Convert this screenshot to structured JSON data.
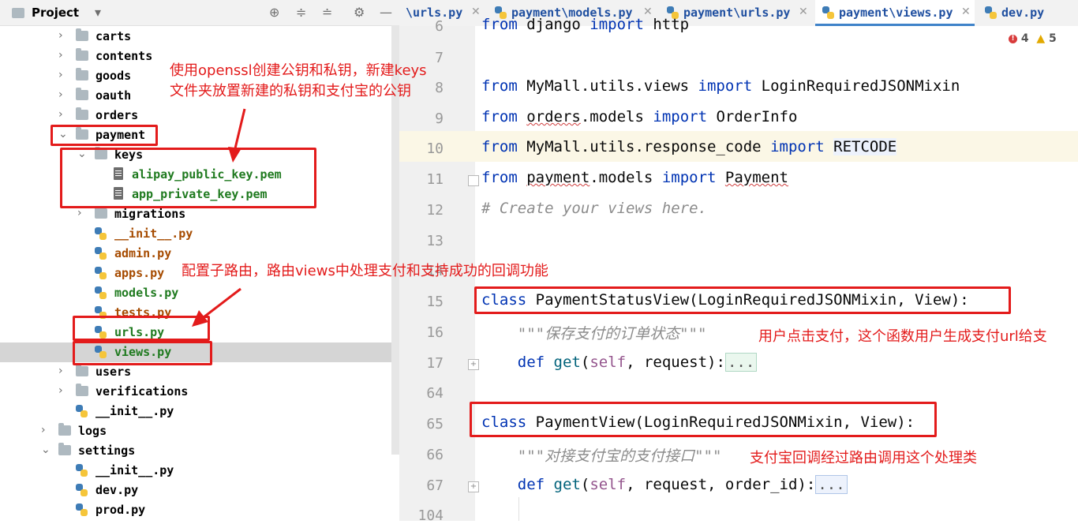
{
  "project_panel": {
    "title": "Project",
    "tree": [
      {
        "label": "carts",
        "kind": "folder",
        "expanded": false
      },
      {
        "label": "contents",
        "kind": "folder",
        "expanded": false
      },
      {
        "label": "goods",
        "kind": "folder",
        "expanded": false
      },
      {
        "label": "oauth",
        "kind": "folder",
        "expanded": false
      },
      {
        "label": "orders",
        "kind": "folder",
        "expanded": false
      },
      {
        "label": "payment",
        "kind": "folder",
        "expanded": true
      },
      {
        "label": "keys",
        "kind": "folder",
        "expanded": true
      },
      {
        "label": "alipay_public_key.pem",
        "kind": "pem"
      },
      {
        "label": "app_private_key.pem",
        "kind": "pem"
      },
      {
        "label": "migrations",
        "kind": "folder",
        "expanded": false
      },
      {
        "label": "__init__.py",
        "kind": "py"
      },
      {
        "label": "admin.py",
        "kind": "py"
      },
      {
        "label": "apps.py",
        "kind": "py"
      },
      {
        "label": "models.py",
        "kind": "py"
      },
      {
        "label": "tests.py",
        "kind": "py"
      },
      {
        "label": "urls.py",
        "kind": "py"
      },
      {
        "label": "views.py",
        "kind": "py",
        "selected": true
      },
      {
        "label": "users",
        "kind": "folder",
        "expanded": false
      },
      {
        "label": "verifications",
        "kind": "folder",
        "expanded": false
      },
      {
        "label": "__init__.py",
        "kind": "py"
      },
      {
        "label": "logs",
        "kind": "folder",
        "expanded": false
      },
      {
        "label": "settings",
        "kind": "folder",
        "expanded": true
      },
      {
        "label": "__init__.py",
        "kind": "py"
      },
      {
        "label": "dev.py",
        "kind": "py"
      },
      {
        "label": "prod.py",
        "kind": "py"
      }
    ]
  },
  "tabs": [
    {
      "label": "\\urls.py"
    },
    {
      "label": "payment\\models.py"
    },
    {
      "label": "payment\\urls.py"
    },
    {
      "label": "payment\\views.py",
      "active": true
    },
    {
      "label": "dev.py"
    }
  ],
  "inspections": {
    "errors": "4",
    "warnings": "5"
  },
  "code_lines": [
    {
      "num": "6",
      "text": "from django import http"
    },
    {
      "num": "7",
      "text": ""
    },
    {
      "num": "8",
      "text": "from MyMall.utils.views import LoginRequiredJSONMixin"
    },
    {
      "num": "9",
      "text": "from orders.models import OrderInfo"
    },
    {
      "num": "10",
      "text": "from MyMall.utils.response_code import RETCODE"
    },
    {
      "num": "11",
      "text": "from payment.models import Payment"
    },
    {
      "num": "12",
      "text": "# Create your views here."
    },
    {
      "num": "13",
      "text": ""
    },
    {
      "num": "14",
      "text": ""
    },
    {
      "num": "15",
      "text": "class PaymentStatusView(LoginRequiredJSONMixin, View):"
    },
    {
      "num": "16",
      "text": "\"\"\"保存支付的订单状态\"\"\""
    },
    {
      "num": "17",
      "text": "def get(self, request):..."
    },
    {
      "num": "64",
      "text": ""
    },
    {
      "num": "65",
      "text": "class PaymentView(LoginRequiredJSONMixin, View):"
    },
    {
      "num": "66",
      "text": "\"\"\"对接支付宝的支付接口\"\"\""
    },
    {
      "num": "67",
      "text": "def get(self, request, order_id):..."
    },
    {
      "num": "104",
      "text": ""
    }
  ],
  "annotations": {
    "keys_note_line1": "使用openssl创建公钥和私钥，新建keys",
    "keys_note_line2": "文件夹放置新建的私钥和支付宝的公钥",
    "urls_note": "配置子路由，路由views中处理支付和支持成功的回调功能",
    "status_view_note": "用户点击支付，这个函数用户生成支付url给支",
    "payment_view_note": "支付宝回调经过路由调用这个处理类"
  },
  "colors": {
    "annotation": "#e31b1b",
    "keyword": "#0033b3",
    "tab_active": "#4083c9"
  }
}
